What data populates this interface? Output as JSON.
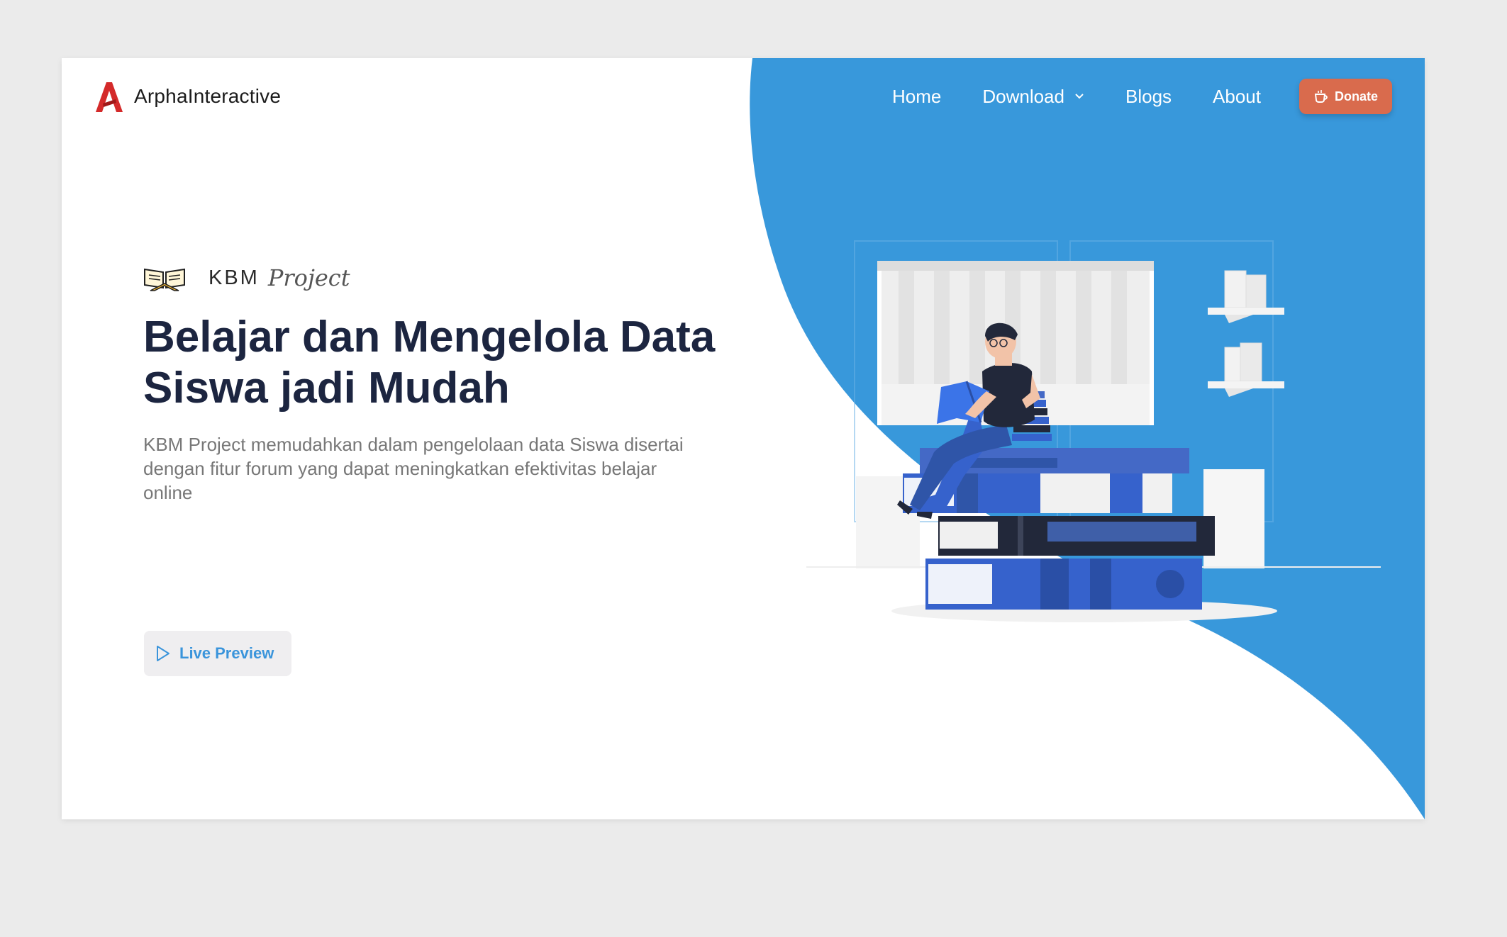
{
  "header": {
    "logo_text": "ArphaInteractive",
    "nav": [
      {
        "label": "Home"
      },
      {
        "label": "Download",
        "has_dropdown": true
      },
      {
        "label": "Blogs"
      },
      {
        "label": "About"
      }
    ],
    "donate_label": "Donate",
    "donate_icon": "coffee-cup-icon"
  },
  "hero": {
    "brand_kbm": "KBM",
    "brand_project": "Project",
    "title": "Belajar dan Mengelola Data Siswa jadi Mudah",
    "description": "KBM Project memudahkan dalam pengelolaan data Siswa disertai dengan fitur forum yang dapat meningkatkan efektivitas belajar online",
    "cta_label": "Live Preview",
    "cta_icon": "play-outline-icon",
    "brand_icon": "open-book-icon"
  },
  "colors": {
    "accent_blue": "#3898db",
    "donate": "#d96b4d",
    "title": "#1c2540",
    "logo_red": "#d42a2a"
  }
}
